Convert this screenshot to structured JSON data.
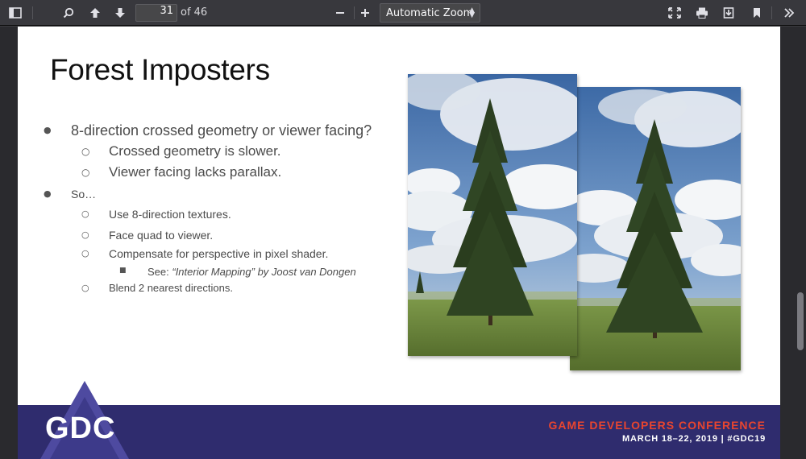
{
  "toolbar": {
    "page_number": "31",
    "page_of": "of 46",
    "zoom_value": "Automatic Zoom",
    "icons": [
      "sidebar-toggle-icon",
      "search-icon",
      "arrow-up-icon",
      "arrow-down-icon",
      "minus-icon",
      "plus-icon",
      "fullscreen-icon",
      "print-icon",
      "download-icon",
      "bookmark-icon",
      "double-chevron-icon"
    ]
  },
  "slide": {
    "title": "Forest Imposters",
    "bullets": [
      {
        "text": "8-direction crossed geometry or viewer facing?"
      },
      {
        "text": "Crossed geometry is slower."
      },
      {
        "text": "Viewer facing lacks parallax."
      },
      {
        "text": "So…"
      },
      {
        "text": "Use 8-direction textures."
      },
      {
        "text": "Face quad to viewer."
      },
      {
        "text": "Compensate for perspective in pixel shader."
      },
      {
        "prefix": "See: ",
        "text": "“Interior Mapping” by Joost van Dongen"
      },
      {
        "text": "Blend 2 nearest directions."
      }
    ],
    "markers": {
      "level1": "●",
      "level2": "○",
      "level3": "■"
    }
  },
  "footer": {
    "logo": "GDC",
    "conference_name": "GAME DEVELOPERS CONFERENCE",
    "conference_dates": "MARCH 18–22, 2019  |  #GDC19"
  },
  "colors": {
    "toolbar_bg": "#38383d",
    "viewer_bg": "#2a2a2e",
    "footer_bg": "#2f2c6e",
    "conference_accent": "#e8452f"
  }
}
